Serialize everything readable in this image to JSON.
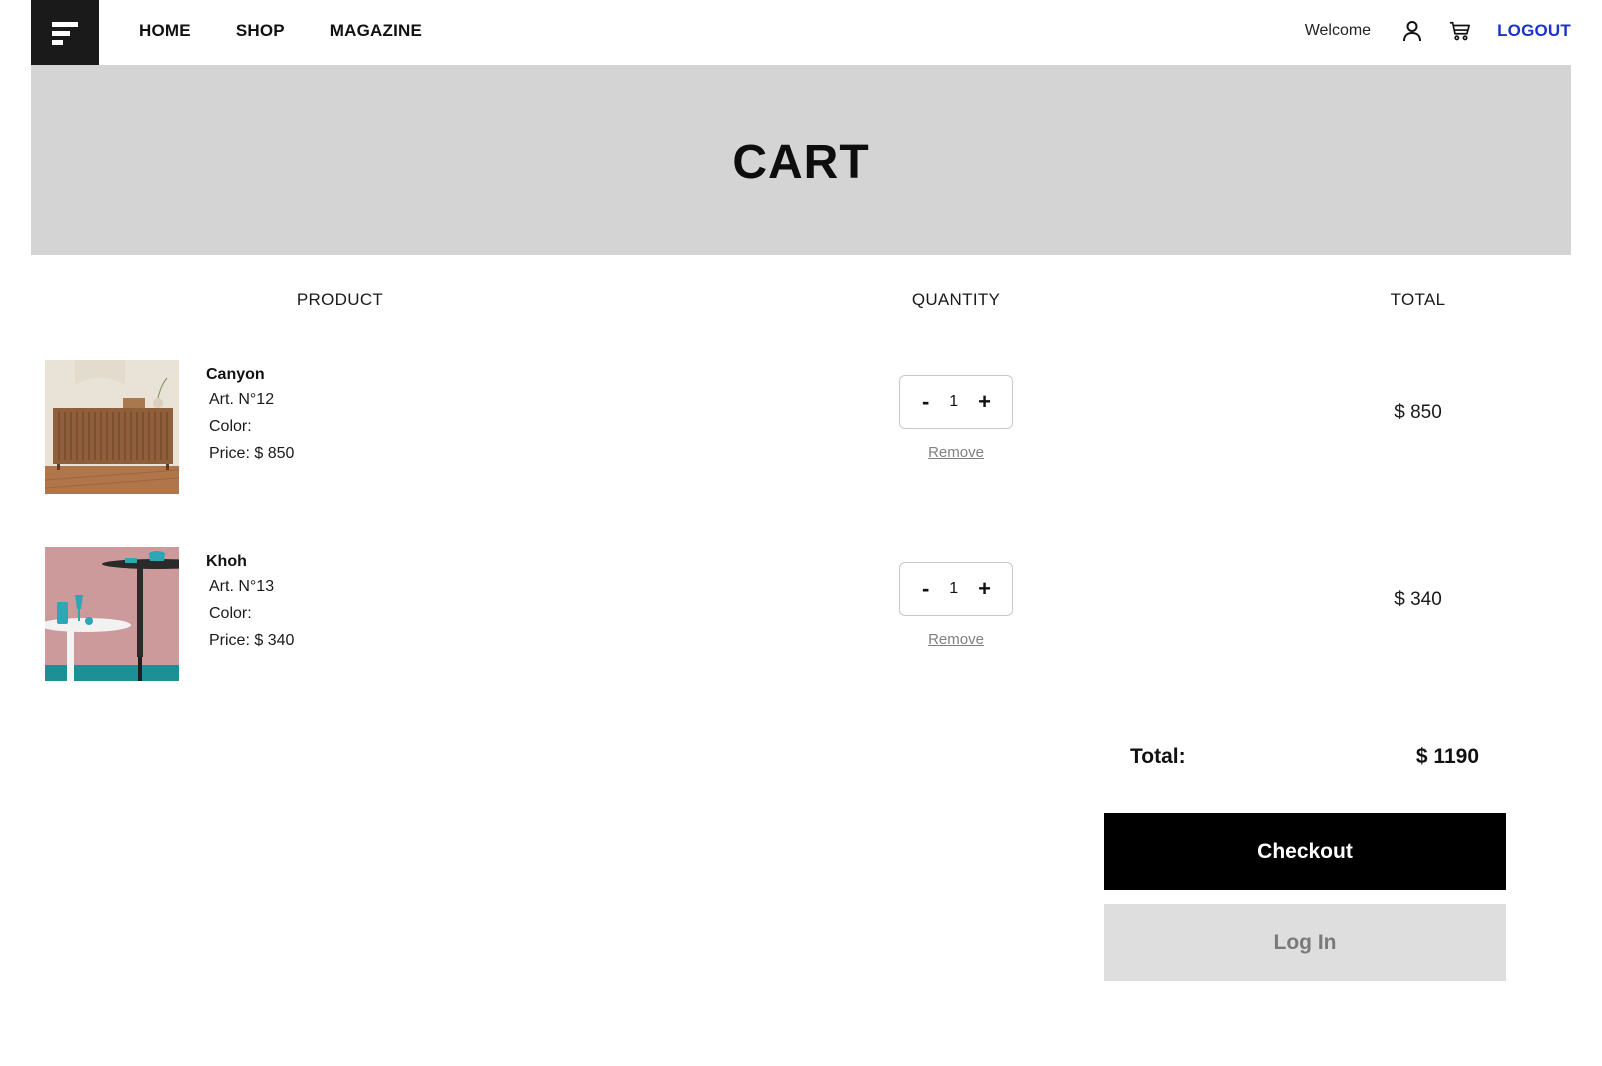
{
  "header": {
    "logo_icon": "menu-lines-icon",
    "nav": [
      "HOME",
      "SHOP",
      "MAGAZINE"
    ],
    "welcome": "Welcome",
    "user_icon": "user-icon",
    "cart_icon": "cart-icon",
    "logout": "LOGOUT",
    "accent_color": "#1a33c9"
  },
  "banner": {
    "title": "CART",
    "background": "#d4d4d4"
  },
  "columns": {
    "product": "PRODUCT",
    "quantity": "QUANTITY",
    "total": "TOTAL"
  },
  "items": [
    {
      "name": "Canyon",
      "art": "Art. N°12",
      "color": "Color:",
      "price": "Price: $ 850",
      "quantity": "1",
      "decrement": "-",
      "increment": "+",
      "remove": "Remove",
      "total": "$ 850"
    },
    {
      "name": "Khoh",
      "art": "Art. N°13",
      "color": "Color:",
      "price": "Price: $ 340",
      "quantity": "1",
      "decrement": "-",
      "increment": "+",
      "remove": "Remove",
      "total": "$ 340"
    }
  ],
  "summary": {
    "total_label": "Total:",
    "total_value": "$ 1190",
    "checkout": "Checkout",
    "login": "Log In"
  }
}
